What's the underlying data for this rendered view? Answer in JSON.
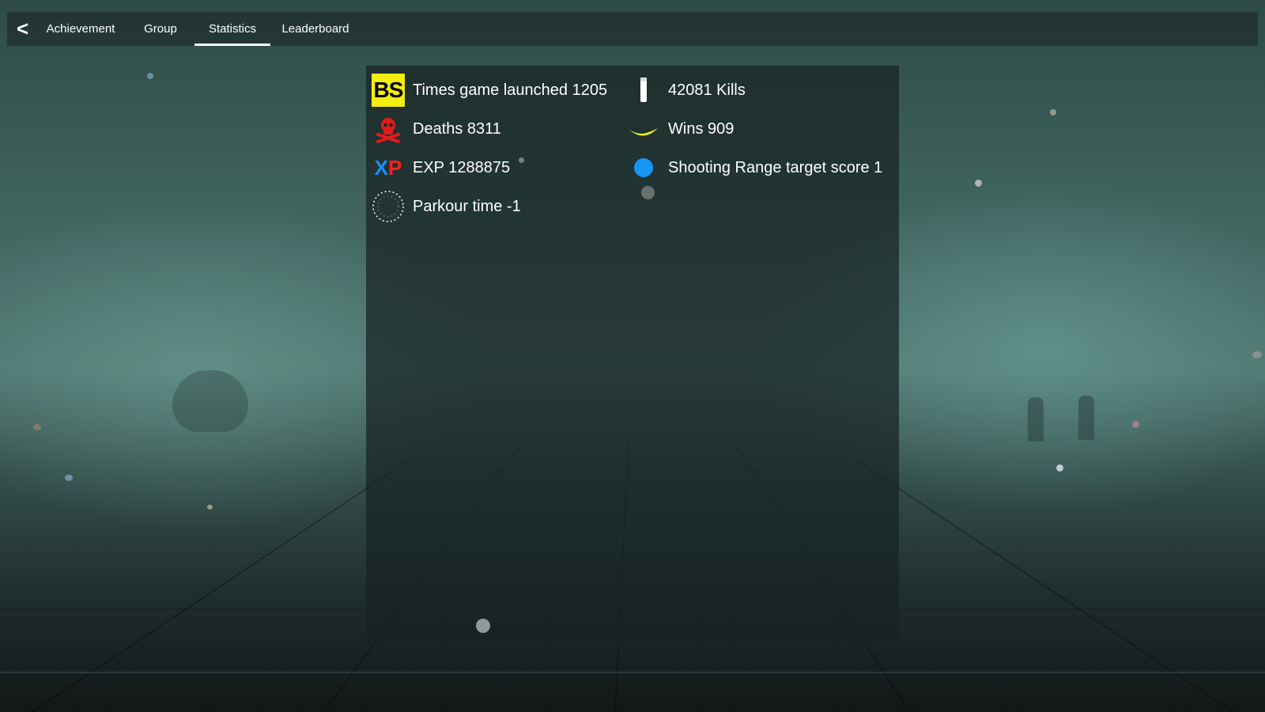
{
  "nav": {
    "back_icon": "<",
    "tabs": [
      {
        "label": "Achievement",
        "active": false
      },
      {
        "label": "Group",
        "active": false
      },
      {
        "label": "Statistics",
        "active": true
      },
      {
        "label": "Leaderboard",
        "active": false
      }
    ]
  },
  "stats": {
    "times_launched": {
      "label": "Times game launched 1205",
      "icon": "bs-logo-icon"
    },
    "kills": {
      "label": "42081 Kills",
      "icon": "bullet-icon"
    },
    "deaths": {
      "label": "Deaths 8311",
      "icon": "skull-crossbones-icon"
    },
    "wins": {
      "label": "Wins 909",
      "icon": "banana-icon"
    },
    "exp": {
      "label": "EXP 1288875",
      "icon": "xp-icon",
      "xp_x": "X",
      "xp_p": "P"
    },
    "shooting_range": {
      "label": "Shooting Range target score 1",
      "icon": "blue-target-icon"
    },
    "parkour": {
      "label": "Parkour time -1",
      "icon": "stopwatch-icon"
    }
  },
  "colors": {
    "bs_yellow": "#f4ee10",
    "skull_red": "#e31b1b",
    "banana_yellow": "#f4ee10",
    "target_blue": "#1896f5",
    "xp_blue": "#1890ff",
    "xp_red": "#ff2020"
  }
}
